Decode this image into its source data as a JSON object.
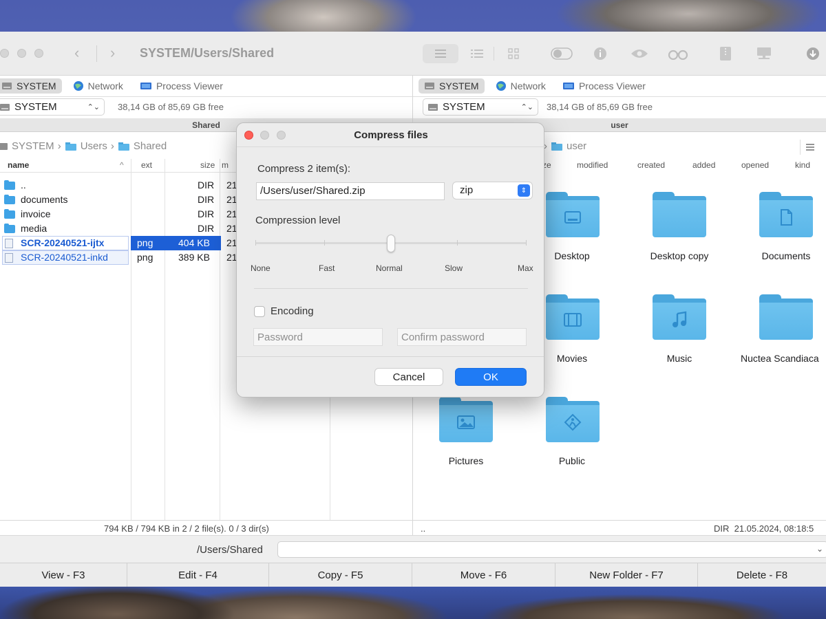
{
  "titlebar": {
    "path": "SYSTEM/Users/Shared"
  },
  "left_panel": {
    "tabs": [
      {
        "label": "SYSTEM",
        "icon": "drive-icon",
        "active": true
      },
      {
        "label": "Network",
        "icon": "globe-icon",
        "active": false
      },
      {
        "label": "Process Viewer",
        "icon": "monitor-icon",
        "active": false
      }
    ],
    "drive": "SYSTEM",
    "free": "38,14 GB of 85,69 GB free",
    "header": "Shared",
    "breadcrumb": [
      "SYSTEM",
      "Users",
      "Shared"
    ],
    "columns": [
      "name",
      "ext",
      "size",
      "m"
    ],
    "files": [
      {
        "name": "..",
        "ext": "",
        "size": "DIR",
        "mod": "21",
        "type": "folder"
      },
      {
        "name": "documents",
        "ext": "",
        "size": "DIR",
        "mod": "21",
        "type": "folder"
      },
      {
        "name": "invoice",
        "ext": "",
        "size": "DIR",
        "mod": "21",
        "type": "folder"
      },
      {
        "name": "media",
        "ext": "",
        "size": "DIR",
        "mod": "21",
        "type": "folder"
      },
      {
        "name": "SCR-20240521-ijtx",
        "ext": "png",
        "size": "404 KB",
        "mod": "21",
        "type": "file",
        "selected": "focused"
      },
      {
        "name": "SCR-20240521-inkd",
        "ext": "png",
        "size": "389 KB",
        "mod": "21",
        "type": "file",
        "selected": "marked"
      }
    ],
    "status": "794 KB / 794 KB in 2 / 2 file(s). 0 / 3 dir(s)"
  },
  "right_panel": {
    "tabs": [
      {
        "label": "SYSTEM",
        "icon": "drive-icon",
        "active": true
      },
      {
        "label": "Network",
        "icon": "globe-icon",
        "active": false
      },
      {
        "label": "Process Viewer",
        "icon": "monitor-icon",
        "active": false
      }
    ],
    "drive": "SYSTEM",
    "free": "38,14 GB of 85,69 GB free",
    "header": "user",
    "breadcrumb_tail": "user",
    "columns": [
      "ze",
      "modified",
      "created",
      "added",
      "opened",
      "kind"
    ],
    "folders": [
      {
        "label": "Desktop",
        "glyph": "desktop-icon"
      },
      {
        "label": "Desktop copy",
        "glyph": ""
      },
      {
        "label": "Documents",
        "glyph": "document-icon"
      },
      {
        "label": "Movies",
        "glyph": "film-icon"
      },
      {
        "label": "Music",
        "glyph": "music-note-icon"
      },
      {
        "label": "Nuctea Scandiaca",
        "glyph": ""
      },
      {
        "label": "Pictures",
        "glyph": "picture-icon"
      },
      {
        "label": "Public",
        "glyph": "public-icon"
      }
    ],
    "status_left": "..",
    "status_right": "DIR  21.05.2024, 08:18:5"
  },
  "command": {
    "path": "/Users/Shared"
  },
  "fkeys": [
    "View - F3",
    "Edit - F4",
    "Copy - F5",
    "Move - F6",
    "New Folder - F7",
    "Delete - F8"
  ],
  "dialog": {
    "title": "Compress files",
    "items_label": "Compress 2 item(s):",
    "archive_path": "/Users/user/Shared.zip",
    "format": "zip",
    "level_label": "Compression level",
    "levels": [
      "None",
      "Fast",
      "Normal",
      "Slow",
      "Max"
    ],
    "selected_level": "Normal",
    "encoding_label": "Encoding",
    "password_placeholder": "Password",
    "confirm_placeholder": "Confirm password",
    "cancel": "Cancel",
    "ok": "OK"
  },
  "colors": {
    "accent": "#1f7bf5",
    "selection": "#1d5fd6",
    "folder": "#5ab6e9"
  }
}
